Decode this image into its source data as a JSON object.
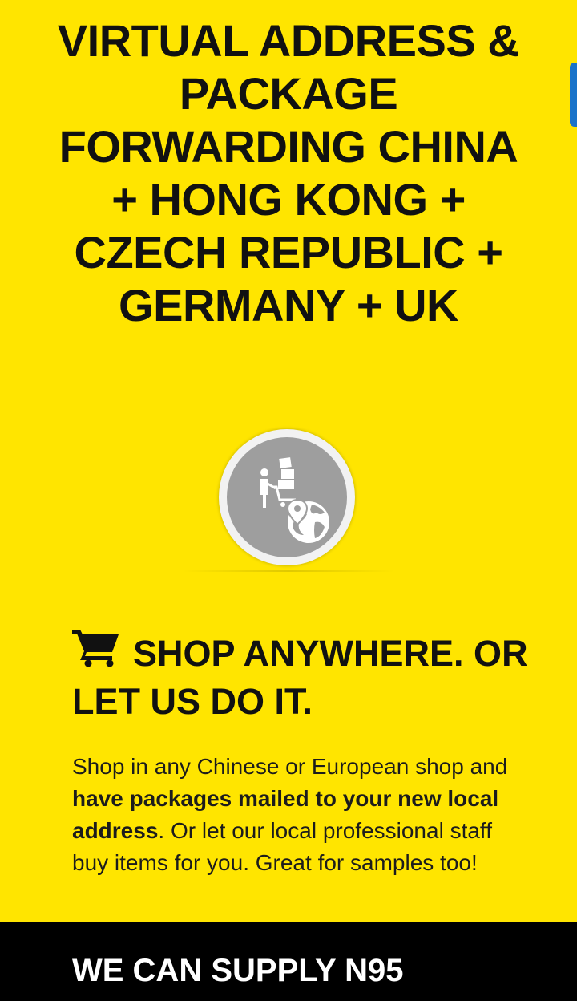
{
  "hero": {
    "title": "VIRTUAL ADDRESS & PACKAGE FORWARDING CHINA + HONG KONG + CZECH REPUBLIC + GERMANY + UK"
  },
  "badge": {
    "icon": "shopping-forwarding-globe-icon"
  },
  "shop_section": {
    "icon": "shopping-cart-icon",
    "heading": "SHOP ANYWHERE. OR LET US DO IT.",
    "text_before": "Shop in any Chinese or European shop and ",
    "text_bold": "have packages mailed to your new local address",
    "text_after": ". Or let our local professional staff buy items for you. Great for samples too!"
  },
  "footer_band": {
    "heading": "WE CAN SUPPLY N95"
  },
  "colors": {
    "background": "#FFE500",
    "text": "#111111",
    "badge": "#9e9e9e",
    "side_tab": "#1a73c9",
    "footer": "#000000"
  }
}
